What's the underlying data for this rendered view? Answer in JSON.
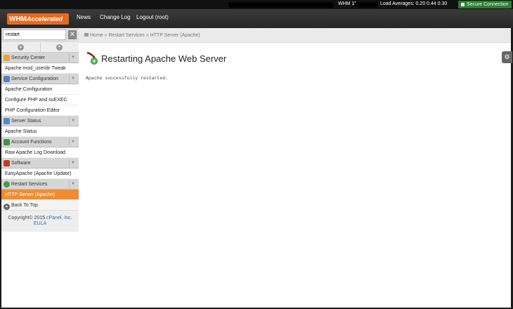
{
  "statusbar": {
    "server_label": "WHM 11",
    "load_label": "Load Averages: 0.20 0.44 0.30",
    "secure_label": "Secure Connection"
  },
  "header": {
    "logo_main": "WHM",
    "logo_sub": "Accelerated",
    "nav": [
      "News",
      "Change Log",
      "Logout (root)"
    ]
  },
  "sidebar": {
    "search_value": "restart",
    "search_clear": "✕",
    "sections": [
      {
        "title": "Security Center",
        "icon_color": "#e8a33a",
        "items": [
          "Apache mod_userdir Tweak"
        ]
      },
      {
        "title": "Service Configuration",
        "icon_color": "#5b7fb5",
        "items": [
          "Apache Configuration",
          "Configure PHP and suEXEC",
          "PHP Configuration Editor"
        ]
      },
      {
        "title": "Server Status",
        "icon_color": "#4a8cc4",
        "items": [
          "Apache Status"
        ]
      },
      {
        "title": "Account Functions",
        "icon_color": "#4a8c4a",
        "items": [
          "Raw Apache Log Download"
        ]
      },
      {
        "title": "Software",
        "icon_color": "#c0392b",
        "items": [
          "EasyApache (Apache Update)"
        ]
      },
      {
        "title": "Restart Services",
        "icon_color": "#3aa33a",
        "items": [
          "HTTP Server (Apache)"
        ]
      }
    ],
    "active_item": "HTTP Server (Apache)",
    "back_to_top": "Back To Top",
    "copyright_text": "Copyright© 2015",
    "copyright_link": "cPanel, Inc.",
    "eula": "EULA"
  },
  "content": {
    "breadcrumb": "Home » Restart Services » HTTP Server (Apache)",
    "page_title": "Restarting Apache Web Server",
    "message": "Apache successfully restarted."
  }
}
